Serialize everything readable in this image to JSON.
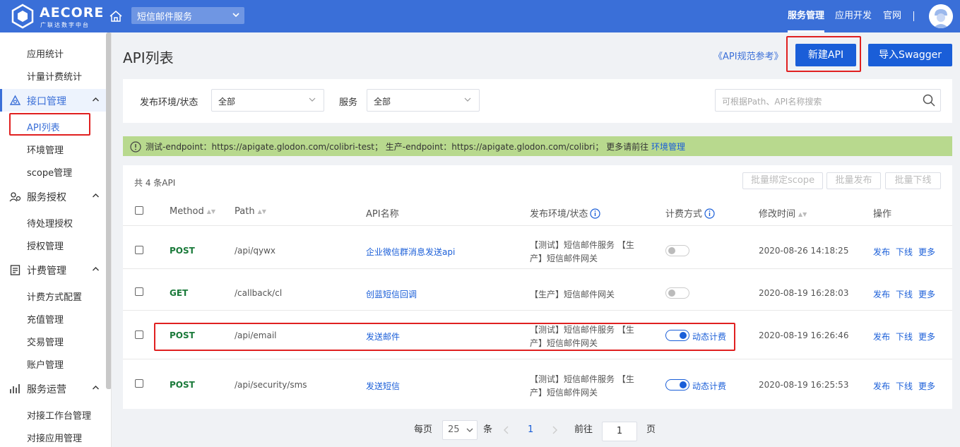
{
  "brand": {
    "name": "AECORE",
    "sub": "广联达数字中台"
  },
  "header": {
    "service_select": "短信邮件服务",
    "nav": [
      {
        "label": "服务管理",
        "active": true
      },
      {
        "label": "应用开发",
        "active": false
      },
      {
        "label": "官网",
        "active": false
      }
    ],
    "separator": "|"
  },
  "sidebar": {
    "items": [
      {
        "type": "item",
        "label": "应用统计"
      },
      {
        "type": "item",
        "label": "计量计费统计"
      },
      {
        "type": "group",
        "label": "接口管理",
        "icon": "interface-icon",
        "active": true
      },
      {
        "type": "item",
        "label": "API列表",
        "active": true
      },
      {
        "type": "item",
        "label": "环境管理"
      },
      {
        "type": "item",
        "label": "scope管理"
      },
      {
        "type": "group",
        "label": "服务授权",
        "icon": "authorization-icon"
      },
      {
        "type": "item",
        "label": "待处理授权"
      },
      {
        "type": "item",
        "label": "授权管理"
      },
      {
        "type": "group",
        "label": "计费管理",
        "icon": "billing-icon"
      },
      {
        "type": "item",
        "label": "计费方式配置"
      },
      {
        "type": "item",
        "label": "充值管理"
      },
      {
        "type": "item",
        "label": "交易管理"
      },
      {
        "type": "item",
        "label": "账户管理"
      },
      {
        "type": "group",
        "label": "服务运营",
        "icon": "operations-icon"
      },
      {
        "type": "item",
        "label": "对接工作台管理"
      },
      {
        "type": "item",
        "label": "对接应用管理"
      }
    ]
  },
  "main": {
    "title": "API列表",
    "spec_link": "《API规范参考》",
    "new_api_button": "新建API",
    "import_button": "导入Swagger",
    "filters": {
      "env_label": "发布环境/状态",
      "env_value": "全部",
      "service_label": "服务",
      "service_value": "全部",
      "search_placeholder": "可根据Path、API名称搜索"
    },
    "notice": {
      "text": "测试-endpoint：https://apigate.glodon.com/colibri-test； 生产-endpoint：https://apigate.glodon.com/colibri； 更多请前往",
      "link": "环境管理"
    },
    "table": {
      "count": "共 4 条API",
      "batch_buttons": [
        "批量绑定scope",
        "批量发布",
        "批量下线"
      ],
      "headers": {
        "method": "Method",
        "path": "Path",
        "name": "API名称",
        "env": "发布环境/状态",
        "billing": "计费方式",
        "modified": "修改时间",
        "ops": "操作"
      },
      "rows": [
        {
          "method": "POST",
          "path": "/api/qywx",
          "name": "企业微信群消息发送api",
          "env": "【测试】短信邮件服务 【生产】短信邮件网关",
          "billing_on": false,
          "billing_label": "",
          "modified": "2020-08-26 14:18:25"
        },
        {
          "method": "GET",
          "path": "/callback/cl",
          "name": "创蓝短信回调",
          "env": "【生产】短信邮件网关",
          "billing_on": false,
          "billing_label": "",
          "modified": "2020-08-19 16:28:03"
        },
        {
          "method": "POST",
          "path": "/api/email",
          "name": "发送邮件",
          "env": "【测试】短信邮件服务 【生产】短信邮件网关",
          "billing_on": true,
          "billing_label": "动态计费",
          "modified": "2020-08-19 16:26:46"
        },
        {
          "method": "POST",
          "path": "/api/security/sms",
          "name": "发送短信",
          "env": "【测试】短信邮件服务 【生产】短信邮件网关",
          "billing_on": true,
          "billing_label": "动态计费",
          "modified": "2020-08-19 16:25:53"
        }
      ],
      "ops": [
        "发布",
        "下线",
        "更多"
      ]
    },
    "pagination": {
      "per_page_label": "每页",
      "per_page_value": "25",
      "unit": "条",
      "current_page": "1",
      "goto_label": "前往",
      "goto_value": "1",
      "page_unit": "页"
    }
  }
}
